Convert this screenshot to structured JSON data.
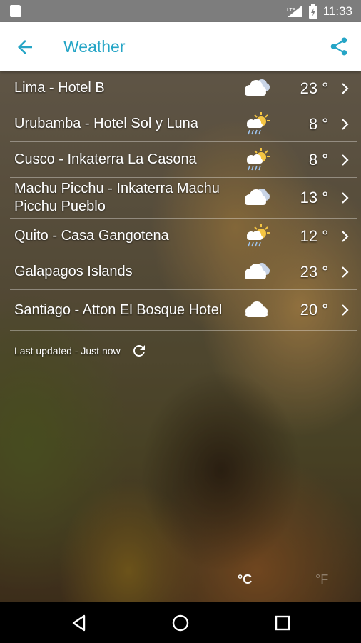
{
  "status_bar": {
    "time": "11:33",
    "network": "LTE"
  },
  "app_bar": {
    "title": "Weather",
    "back_icon": "arrow-left-icon",
    "share_icon": "share-icon"
  },
  "locations": [
    {
      "name": "Lima - Hotel B",
      "temp": "23 °",
      "icon": "partly-cloudy-icon"
    },
    {
      "name": "Urubamba - Hotel Sol y Luna",
      "temp": "8 °",
      "icon": "sun-rain-icon"
    },
    {
      "name": "Cusco - Inkaterra La Casona",
      "temp": "8 °",
      "icon": "sun-rain-icon"
    },
    {
      "name": "Machu Picchu - Inkaterra Machu Picchu Pueblo",
      "temp": "13 °",
      "icon": "partly-cloudy-icon"
    },
    {
      "name": "Quito - Casa Gangotena",
      "temp": "12 °",
      "icon": "sun-rain-icon"
    },
    {
      "name": "Galapagos Islands",
      "temp": "23 °",
      "icon": "partly-cloudy-icon"
    },
    {
      "name": "Santiago - Atton El Bosque Hotel",
      "temp": "20 °",
      "icon": "cloud-icon"
    }
  ],
  "last_updated": "Last updated - Just now",
  "units": {
    "celsius": "°C",
    "fahrenheit": "°F",
    "selected": "celsius"
  },
  "colors": {
    "accent": "#25a5c6",
    "status_bar": "#7d7d7d",
    "app_bar": "#ffffff",
    "nav_bar": "#000000"
  }
}
